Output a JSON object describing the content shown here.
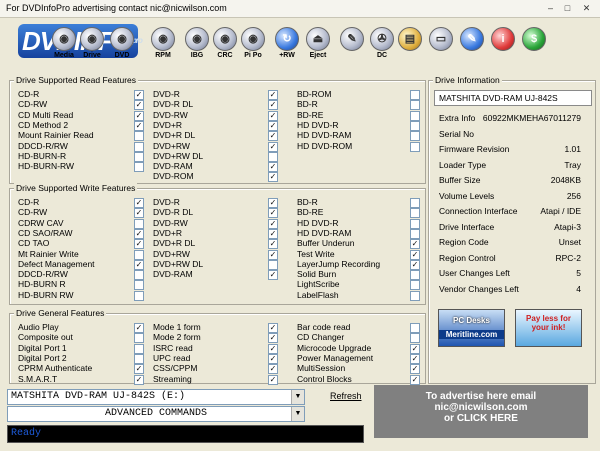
{
  "window": {
    "title": "For DVDInfoPro advertising contact nic@nicwilson.com"
  },
  "brand": {
    "logo": "DVDINFO",
    "logo_sup": "pro"
  },
  "toolbar": [
    "Media",
    "Drive",
    "DVD",
    "RPM",
    "IBG",
    "CRC",
    "Pi Po",
    "+RW",
    "Eject",
    "",
    "DC",
    "",
    "",
    "",
    "",
    ""
  ],
  "read_features": {
    "title": "Drive Supported Read Features",
    "col1": [
      [
        "CD-R",
        true
      ],
      [
        "CD-RW",
        true
      ],
      [
        "CD Multi Read",
        true
      ],
      [
        "CD Method 2",
        true
      ],
      [
        "Mount Rainier Read",
        false
      ],
      [
        "DDCD-R/RW",
        false
      ],
      [
        "HD-BURN-R",
        false
      ],
      [
        "HD-BURN-RW",
        false
      ]
    ],
    "col2": [
      [
        "DVD-R",
        true
      ],
      [
        "DVD-R DL",
        true
      ],
      [
        "DVD-RW",
        true
      ],
      [
        "DVD+R",
        true
      ],
      [
        "DVD+R DL",
        true
      ],
      [
        "DVD+RW",
        true
      ],
      [
        "DVD+RW DL",
        false
      ],
      [
        "DVD-RAM",
        true
      ],
      [
        "DVD-ROM",
        true
      ]
    ],
    "col3": [
      [
        "BD-ROM",
        false
      ],
      [
        "BD-R",
        false
      ],
      [
        "BD-RE",
        false
      ],
      [
        "HD DVD-R",
        false
      ],
      [
        "HD DVD-RAM",
        false
      ],
      [
        "HD DVD-ROM",
        false
      ]
    ]
  },
  "write_features": {
    "title": "Drive Supported Write Features",
    "col1": [
      [
        "CD-R",
        true
      ],
      [
        "CD-RW",
        true
      ],
      [
        "CDRW CAV",
        false
      ],
      [
        "CD SAO/RAW",
        true
      ],
      [
        "CD TAO",
        true
      ],
      [
        "Mt Rainier Write",
        false
      ],
      [
        "Defect Management",
        true
      ],
      [
        "DDCD-R/RW",
        false
      ],
      [
        "HD-BURN R",
        false
      ],
      [
        "HD-BURN RW",
        false
      ]
    ],
    "col2": [
      [
        "DVD-R",
        true
      ],
      [
        "DVD-R DL",
        true
      ],
      [
        "DVD-RW",
        true
      ],
      [
        "DVD+R",
        true
      ],
      [
        "DVD+R DL",
        true
      ],
      [
        "DVD+RW",
        true
      ],
      [
        "DVD+RW DL",
        false
      ],
      [
        "DVD-RAM",
        true
      ]
    ],
    "col3": [
      [
        "BD-R",
        false
      ],
      [
        "BD-RE",
        false
      ],
      [
        "HD DVD-R",
        false
      ],
      [
        "HD DVD-RAM",
        false
      ],
      [
        "Buffer Underun",
        true
      ],
      [
        "Test Write",
        true
      ],
      [
        "LayerJump Recording",
        true
      ],
      [
        "Solid Burn",
        false
      ],
      [
        "LightScribe",
        false
      ],
      [
        "LabelFlash",
        false
      ]
    ]
  },
  "general_features": {
    "title": "Drive General Features",
    "col1": [
      [
        "Audio Play",
        true
      ],
      [
        "Composite out",
        false
      ],
      [
        "Digital Port 1",
        false
      ],
      [
        "Digital Port 2",
        false
      ],
      [
        "CPRM Authenticate",
        true
      ],
      [
        "S.M.A.R.T",
        true
      ]
    ],
    "col2": [
      [
        "Mode 1 form",
        true
      ],
      [
        "Mode 2 form",
        true
      ],
      [
        "ISRC read",
        true
      ],
      [
        "UPC read",
        true
      ],
      [
        "CSS/CPPM",
        true
      ],
      [
        "Streaming",
        true
      ]
    ],
    "col3": [
      [
        "Bar code read",
        false
      ],
      [
        "CD Changer",
        false
      ],
      [
        "Microcode Upgrade",
        true
      ],
      [
        "Power Management",
        true
      ],
      [
        "MultiSession",
        true
      ],
      [
        "Control Blocks",
        true
      ]
    ]
  },
  "drive_info": {
    "title": "Drive Information",
    "drive": "MATSHITA DVD-RAM UJ-842S",
    "rows": [
      [
        "Extra Info",
        "60922MKMEHA67011279"
      ],
      [
        "Serial No",
        ""
      ],
      [
        "Firmware Revision",
        "1.01"
      ],
      [
        "Loader Type",
        "Tray"
      ],
      [
        "Buffer Size",
        "2048KB"
      ],
      [
        "Volume Levels",
        "256"
      ],
      [
        "Connection Interface",
        "Atapi / IDE"
      ],
      [
        "Drive Interface",
        "Atapi-3"
      ],
      [
        "Region Code",
        "Unset"
      ],
      [
        "Region Control",
        "RPC-2"
      ],
      [
        "User Changes Left",
        "5"
      ],
      [
        "Vendor Changes Left",
        "4"
      ]
    ]
  },
  "ads": {
    "ad1_line1": "PC Desks",
    "ad1_line2": "Meritline.com",
    "ad2_line1": "Pay less for",
    "ad2_line2": "your ink!"
  },
  "bottom": {
    "drive_select": "MATSHITA DVD-RAM UJ-842S (E:)",
    "commands": "ADVANCED COMMANDS",
    "refresh": "Refresh",
    "advert": [
      "To advertise here email",
      "nic@nicwilson.com",
      "or CLICK HERE"
    ],
    "status": "Ready"
  }
}
